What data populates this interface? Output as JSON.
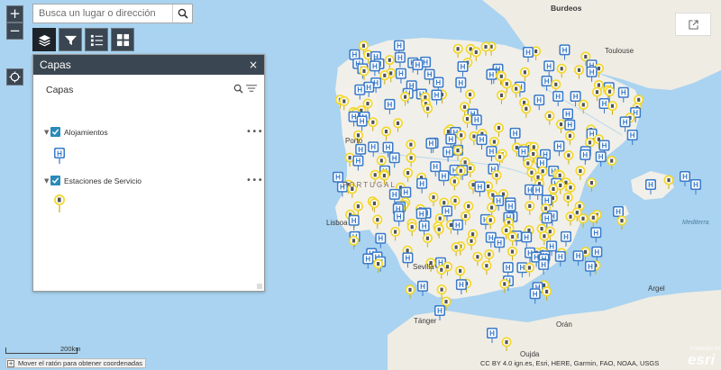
{
  "search": {
    "placeholder": "Busca un lugar o dirección"
  },
  "zoom": {
    "in_label": "+",
    "out_label": "−"
  },
  "panel": {
    "title": "Capas",
    "close_label": "×",
    "subtitle": "Capas",
    "layers": [
      {
        "label": "Alojamientos",
        "checked": true,
        "symbol": "hotel-pin"
      },
      {
        "label": "Estaciones de Servicio",
        "checked": true,
        "symbol": "fuel-pin"
      }
    ],
    "more_label": "•••"
  },
  "map_labels": {
    "burdeos": "Burdeos",
    "toulouse": "Toulouse",
    "porto": "Porto",
    "portugal": "PORTUGAL",
    "lisboa": "Lisboa",
    "sevilla": "Sevilla",
    "tanger": "Tánger",
    "argel": "Argel",
    "oran": "Orán",
    "oujda": "Oujda",
    "mediterranean_sea": "Mediterra"
  },
  "scale": {
    "label": "200km"
  },
  "coords": {
    "toggle_label": "+",
    "text": "Mover el ratón para obtener coordenadas"
  },
  "attribution": "CC BY 4.0 ign.es, Esri, HERE, Garmin, FAO, NOAA, USGS",
  "esri": {
    "powered_by": "POWERED BY",
    "logo": "esri"
  },
  "colors": {
    "hotel": "#3a7ac9",
    "fuel": "#f2d72c",
    "sea": "#a9d3f0",
    "land": "#f1efe9",
    "toolbar": "#3a4651"
  }
}
